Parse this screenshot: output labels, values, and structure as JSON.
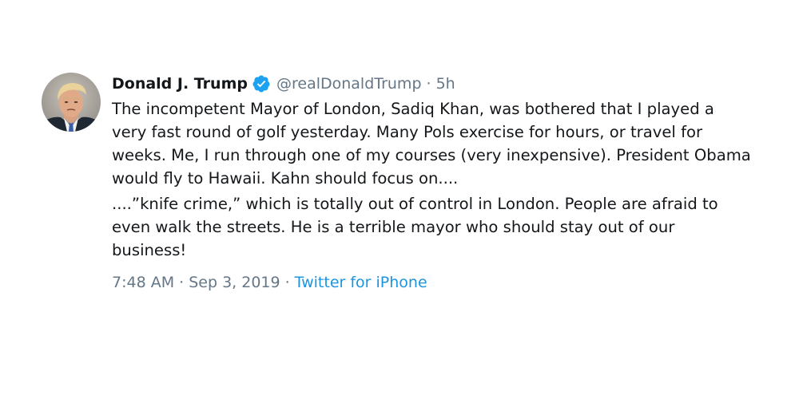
{
  "tweet": {
    "display_name": "Donald J. Trump",
    "handle": "@realDonaldTrump",
    "separator": "·",
    "time_ago": "5h",
    "verified": true,
    "avatar_icon": "profile-photo",
    "paragraphs": [
      "The incompetent Mayor of London, Sadiq Khan, was bothered that I played a very fast round of golf yesterday. Many Pols exercise for hours, or travel for weeks. Me, I run through one of my courses (very inexpensive). President Obama would fly to Hawaii. Kahn should focus on....",
      "....”knife crime,” which is totally out of control in London. People are afraid to even walk the streets. He is a terrible mayor who should stay out of our business!"
    ],
    "timestamp": "7:48 AM · Sep 3, 2019",
    "footer_separator": "·",
    "source": "Twitter for iPhone"
  },
  "colors": {
    "text": "#14171a",
    "secondary": "#657786",
    "link": "#1b95e0",
    "verified": "#1da1f2"
  }
}
